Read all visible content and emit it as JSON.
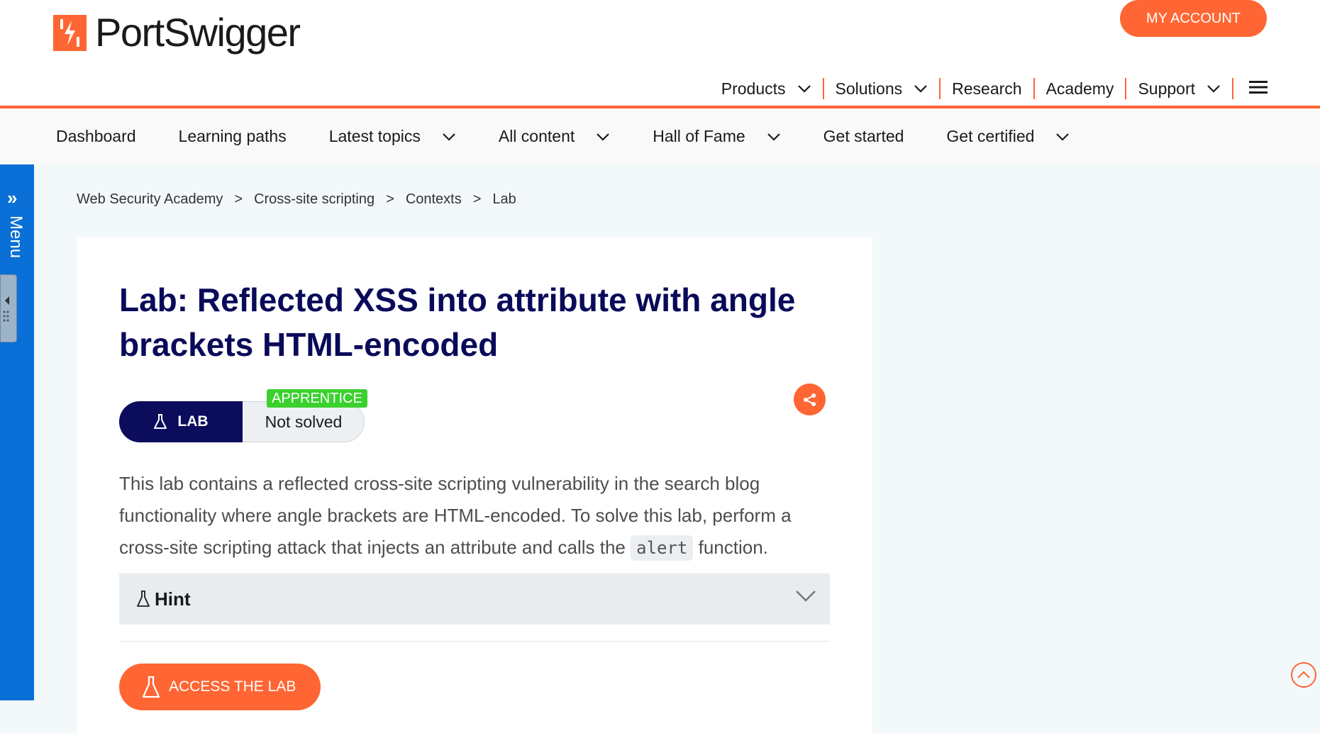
{
  "brand": {
    "name": "PortSwigger",
    "accent": "#ff6633"
  },
  "header": {
    "account_button": "MY ACCOUNT",
    "nav": [
      {
        "label": "Products",
        "dropdown": true
      },
      {
        "label": "Solutions",
        "dropdown": true
      },
      {
        "label": "Research",
        "dropdown": false
      },
      {
        "label": "Academy",
        "dropdown": false
      },
      {
        "label": "Support",
        "dropdown": true
      }
    ]
  },
  "academy_nav": [
    {
      "label": "Dashboard",
      "dropdown": false
    },
    {
      "label": "Learning paths",
      "dropdown": false
    },
    {
      "label": "Latest topics",
      "dropdown": true
    },
    {
      "label": "All content",
      "dropdown": true
    },
    {
      "label": "Hall of Fame",
      "dropdown": true
    },
    {
      "label": "Get started",
      "dropdown": false
    },
    {
      "label": "Get certified",
      "dropdown": true
    }
  ],
  "side_menu": {
    "label": "Menu",
    "color": "#0a6fd6"
  },
  "breadcrumb": [
    "Web Security Academy",
    "Cross-site scripting",
    "Contexts",
    "Lab"
  ],
  "breadcrumb_separator": ">",
  "lab": {
    "title": "Lab: Reflected XSS into attribute with angle brackets HTML-encoded",
    "type_label": "LAB",
    "level": "APPRENTICE",
    "status": "Not solved",
    "description_before": "This lab contains a reflected cross-site scripting vulnerability in the search blog functionality where angle brackets are HTML-encoded. To solve this lab, perform a cross-site scripting attack that injects an attribute and calls the ",
    "description_code": "alert",
    "description_after": " function.",
    "hint_label": "Hint",
    "access_button": "ACCESS THE LAB"
  }
}
